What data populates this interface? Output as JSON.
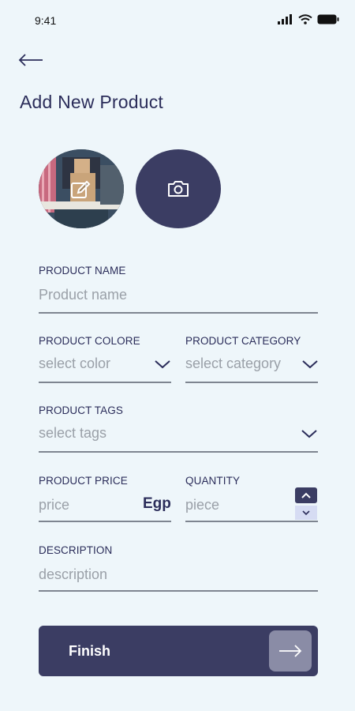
{
  "status_bar": {
    "time": "9:41",
    "icons": [
      "signal-icon",
      "wifi-icon",
      "battery-icon"
    ]
  },
  "header": {
    "back_icon": "arrow-left-icon",
    "title": "Add New Product"
  },
  "photos": {
    "thumbnail_edit_icon": "edit-icon",
    "add_photo_icon": "camera-icon"
  },
  "form": {
    "product_name": {
      "label": "PRODUCT NAME",
      "placeholder": "Product name",
      "value": ""
    },
    "product_color": {
      "label": "PRODUCT COLORE",
      "placeholder": "select color",
      "icon": "chevron-down-icon"
    },
    "product_category": {
      "label": "PRODUCT CATEGORY",
      "placeholder": "select category",
      "icon": "chevron-down-icon"
    },
    "product_tags": {
      "label": "PRODUCT TAGS",
      "placeholder": "select tags",
      "icon": "chevron-down-icon"
    },
    "product_price": {
      "label": "PRODUCT PRICE",
      "placeholder": "price",
      "currency": "Egp"
    },
    "quantity": {
      "label": "QUANTITY",
      "placeholder": "piece",
      "up_icon": "chevron-up-icon",
      "down_icon": "chevron-down-icon"
    },
    "description": {
      "label": "DESCRIPTION",
      "placeholder": "description"
    }
  },
  "finish_button": {
    "label": "Finish",
    "icon": "arrow-right-icon"
  },
  "colors": {
    "background": "#eef6fa",
    "primary": "#3b3d63",
    "text": "#2b2d5a",
    "placeholder": "#9aa0a8",
    "underline": "#7e8590"
  }
}
